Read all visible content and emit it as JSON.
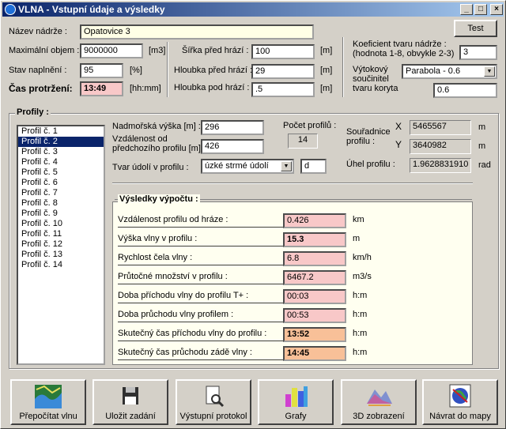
{
  "window": {
    "title": "VLNA - Vstupní údaje a výsledky",
    "controls": {
      "minimize": "_",
      "maximize": "□",
      "close": "×"
    }
  },
  "test_button": "Test",
  "inputs": {
    "nazev_label": "Název nádrže :",
    "nazev_value": "Opatovice 3",
    "objem_label": "Maximální objem :",
    "objem_value": "9000000",
    "objem_unit": "[m3]",
    "stav_label": "Stav naplnění :",
    "stav_value": "95",
    "stav_unit": "[%]",
    "cas_label": "Čas protržení:",
    "cas_value": "13:49",
    "cas_unit": "[hh:mm]",
    "sirka_label": "Šířka před hrází :",
    "sirka_value": "100",
    "sirka_unit": "[m]",
    "hloubka_pred_label": "Hloubka před hrází :",
    "hloubka_pred_value": "29",
    "hloubka_pred_unit": "[m]",
    "hloubka_pod_label": "Hloubka pod hrází :",
    "hloubka_pod_value": ".5",
    "hloubka_pod_unit": "[m]",
    "koef_label_1": "Koeficient tvaru nádrže :",
    "koef_label_2": "(hodnota 1-8, obvykle 2-3)",
    "koef_value": "3",
    "vytok_label_1": "Výtokový",
    "vytok_label_2": "součinitel",
    "vytok_label_3": "tvaru koryta",
    "vytok_select": "Parabola - 0.6",
    "vytok_value": "0.6"
  },
  "profily": {
    "title": "Profily :",
    "items": [
      "Profil č. 1",
      "Profil č. 2",
      "Profil č. 3",
      "Profil č. 4",
      "Profil č. 5",
      "Profil č. 6",
      "Profil č. 7",
      "Profil č. 8",
      "Profil č. 9",
      "Profil č. 10",
      "Profil č. 11",
      "Profil č. 12",
      "Profil č. 13",
      "Profil č. 14"
    ],
    "selected_index": 1,
    "nadm_label": "Nadmořská výška [m] :",
    "nadm_value": "296",
    "vzdal_label_1": "Vzdálenost od",
    "vzdal_label_2": "předchozího profilu [m]",
    "vzdal_value": "426",
    "tvar_label": "Tvar údolí v profilu :",
    "tvar_select": "úzké strmé údolí",
    "tvar_code": "d",
    "pocet_label": "Počet profilů :",
    "pocet_value": "14",
    "souradnice_label_1": "Souřadnice",
    "souradnice_label_2": "profilu :",
    "x_label": "X",
    "x_value": "5465567",
    "x_unit": "m",
    "y_label": "Y",
    "y_value": "3640982",
    "y_unit": "m",
    "uhel_label": "Úhel profilu :",
    "uhel_value": "1.9628831910",
    "uhel_unit": "rad"
  },
  "results": {
    "title": "Výsledky výpočtu :",
    "rows": [
      {
        "label": "Vzdálenost profilu od hráze :",
        "value": "0.426",
        "unit": "km"
      },
      {
        "label": "Výška vlny v profilu :",
        "value": "15.3",
        "unit": "m"
      },
      {
        "label": "Rychlost čela vlny :",
        "value": "6.8",
        "unit": "km/h"
      },
      {
        "label": "Průtočné množství v profilu :",
        "value": "6467.2",
        "unit": "m3/s"
      },
      {
        "label": "Doba příchodu vlny do profilu T+ :",
        "value": "00:03",
        "unit": "h:m"
      },
      {
        "label": "Doba průchodu vlny profilem :",
        "value": "00:53",
        "unit": "h:m"
      },
      {
        "label": "Skutečný čas příchodu vlny do profilu :",
        "value": "13:52",
        "unit": "h:m"
      },
      {
        "label": "Skutečný čas průchodu zádě vlny :",
        "value": "14:45",
        "unit": "h:m"
      }
    ]
  },
  "toolbar": {
    "buttons": [
      {
        "label": "Přepočítat vlnu",
        "icon": "wave-map-icon"
      },
      {
        "label": "Uložit zadání",
        "icon": "floppy-disk-icon"
      },
      {
        "label": "Výstupní protokol",
        "icon": "document-magnifier-icon"
      },
      {
        "label": "Grafy",
        "icon": "bar-chart-icon"
      },
      {
        "label": "3D zobrazení",
        "icon": "3d-terrain-icon"
      },
      {
        "label": "Návrat do mapy",
        "icon": "globe-icon"
      }
    ]
  },
  "colors": {
    "title_start": "#0a246a",
    "title_end": "#a6caf0",
    "input_yellow": "#ffffe6",
    "result_pink": "#f8c8c8",
    "result_orange": "#f8c098",
    "results_panel": "#fffff0"
  }
}
